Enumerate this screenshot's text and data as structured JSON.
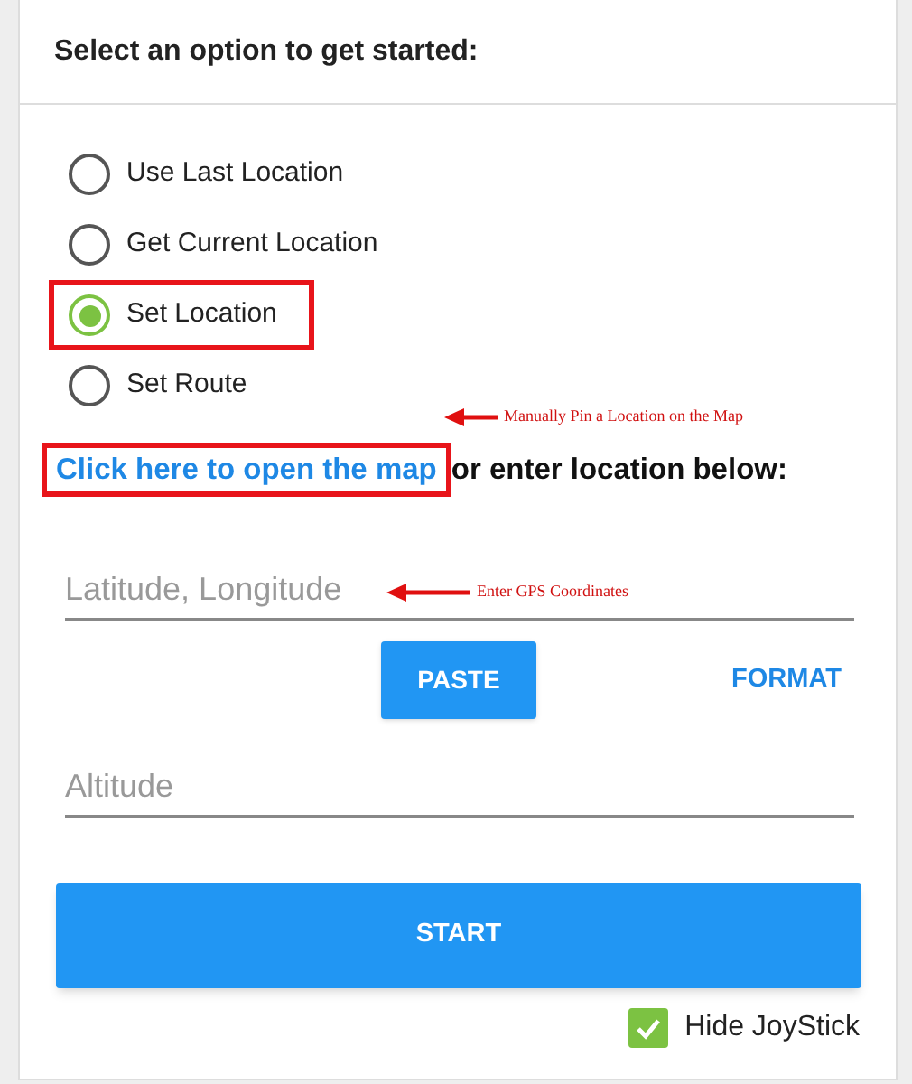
{
  "heading": "Select an option to get started:",
  "options": [
    {
      "label": "Use Last Location",
      "selected": false,
      "highlighted": false
    },
    {
      "label": "Get Current Location",
      "selected": false,
      "highlighted": false
    },
    {
      "label": "Set Location",
      "selected": true,
      "highlighted": true
    },
    {
      "label": "Set Route",
      "selected": false,
      "highlighted": false
    }
  ],
  "map_link": {
    "label": "Click here to open the map",
    "highlighted": true,
    "note": "Manually Pin a Location on the Map"
  },
  "map_link_suffix": "or enter location below:",
  "coordinates_field": {
    "placeholder": "Latitude, Longitude",
    "note": "Enter GPS Coordinates"
  },
  "paste_button": "PASTE",
  "format_button": "FORMAT",
  "altitude_field": {
    "placeholder": "Altitude"
  },
  "start_button": "START",
  "hide_joystick": {
    "label": "Hide JoyStick",
    "checked": true
  }
}
